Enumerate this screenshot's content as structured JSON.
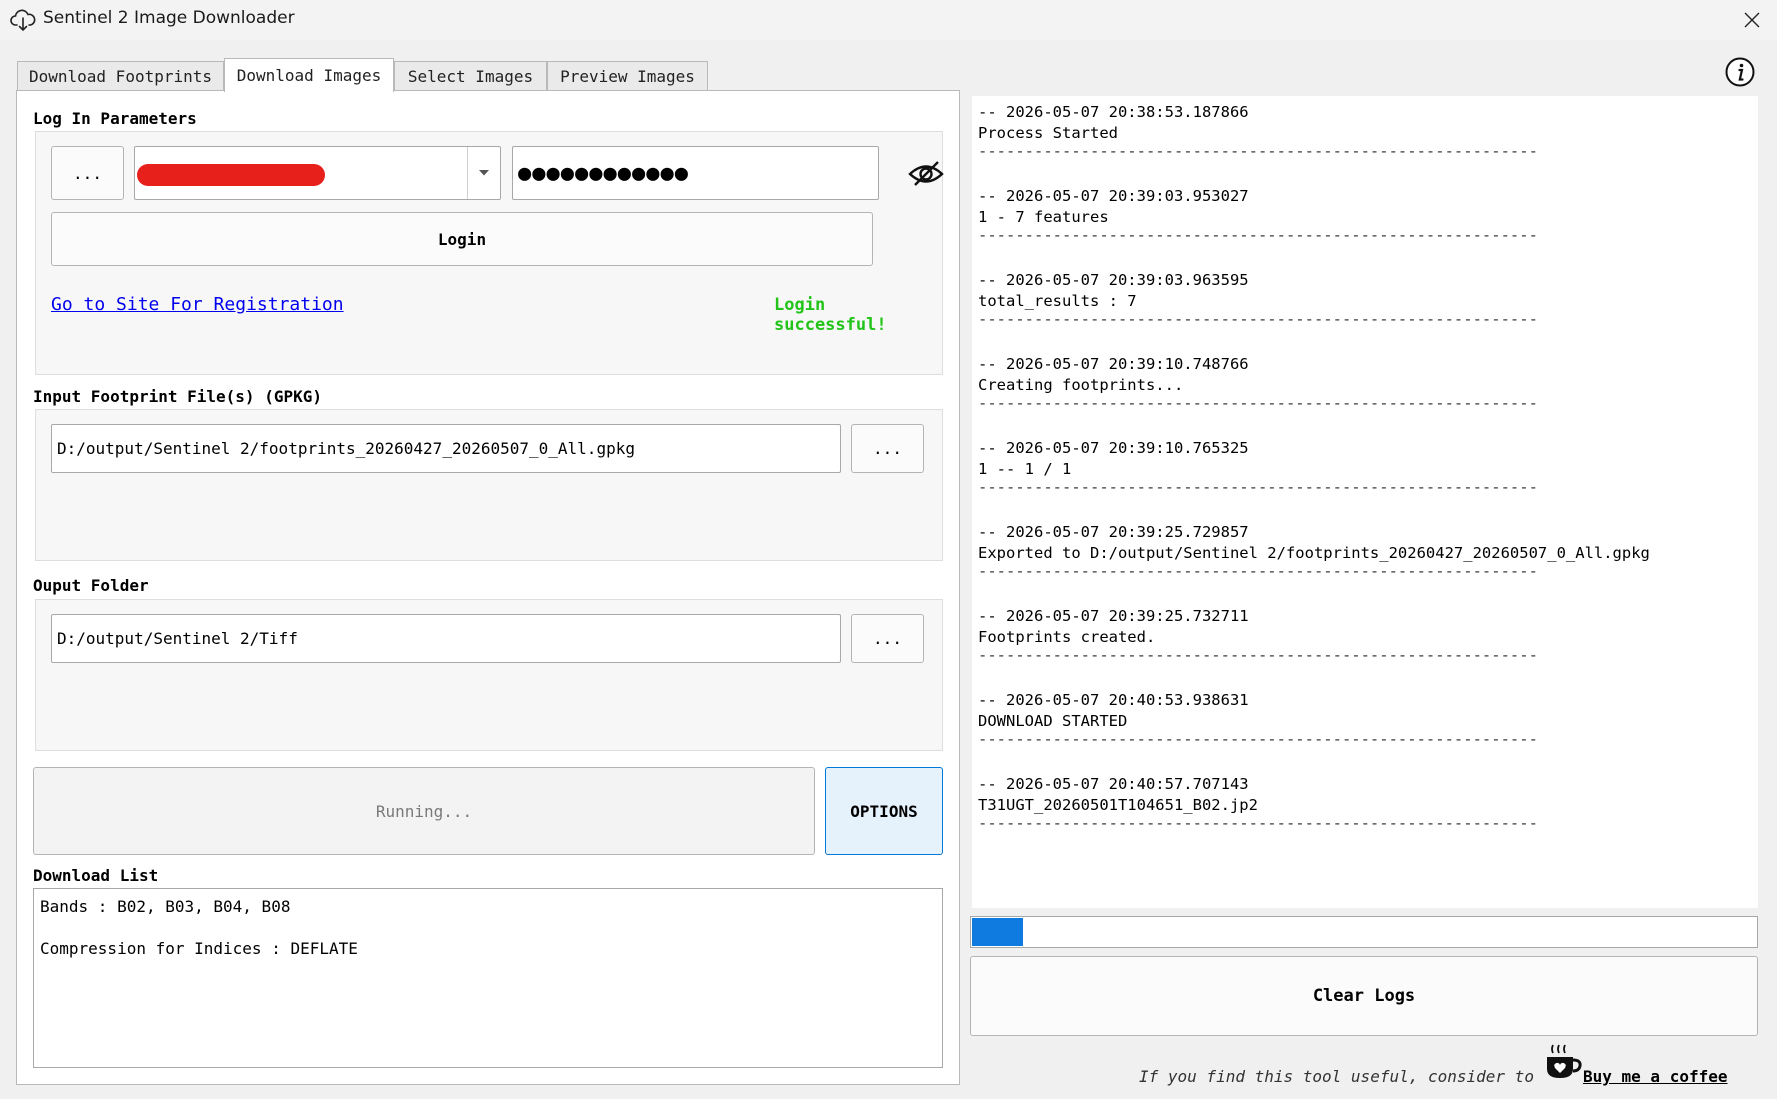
{
  "window": {
    "title": "Sentinel 2 Image Downloader"
  },
  "tabs": [
    {
      "label": "Download Footprints"
    },
    {
      "label": "Download Images"
    },
    {
      "label": "Select Images"
    },
    {
      "label": "Preview Images"
    }
  ],
  "login": {
    "group_label": "Log In Parameters",
    "browse_label": "...",
    "password_mask": "●●●●●●●●●●●●",
    "login_button": "Login",
    "register_link": "Go to Site For Registration",
    "status": "Login successful!"
  },
  "footprint": {
    "group_label": "Input Footprint File(s) (GPKG)",
    "path": "D:/output/Sentinel 2/footprints_20260427_20260507_0_All.gpkg",
    "browse_label": "..."
  },
  "output": {
    "group_label": "Ouput Folder",
    "path": "D:/output/Sentinel 2/Tiff",
    "browse_label": "..."
  },
  "run": {
    "running_label": "Running...",
    "options_label": "OPTIONS"
  },
  "download_list": {
    "label": "Download List",
    "line1": "Bands : B02, B03, B04, B08",
    "line2": "Compression for Indices : DEFLATE"
  },
  "logs": [
    {
      "time": "-- 2026-05-07 20:38:53.187866",
      "msg": "Process Started"
    },
    {
      "time": "-- 2026-05-07 20:39:03.953027",
      "msg": "1 - 7 features"
    },
    {
      "time": "-- 2026-05-07 20:39:03.963595",
      "msg": "total_results : 7"
    },
    {
      "time": "-- 2026-05-07 20:39:10.748766",
      "msg": "Creating footprints..."
    },
    {
      "time": "-- 2026-05-07 20:39:10.765325",
      "msg": "1 -- 1 / 1"
    },
    {
      "time": "-- 2026-05-07 20:39:25.729857",
      "msg": "Exported to D:/output/Sentinel 2/footprints_20260427_20260507_0_All.gpkg"
    },
    {
      "time": "-- 2026-05-07 20:39:25.732711",
      "msg": "Footprints created."
    },
    {
      "time": "-- 2026-05-07 20:40:53.938631",
      "msg": "DOWNLOAD STARTED"
    },
    {
      "time": "-- 2026-05-07 20:40:57.707143",
      "msg": "T31UGT_20260501T104651_B02.jp2"
    }
  ],
  "log_separator": "------------------------------------------------------------",
  "progress": {
    "value": 0.065,
    "color": "#0f7be0"
  },
  "clear_logs_label": "Clear Logs",
  "footer": {
    "text": "If you find this tool useful, consider to",
    "coffee_link": "Buy me a coffee"
  },
  "colors": {
    "status_green": "#22c41a",
    "link_blue": "#0000ee",
    "redaction": "#e8201c"
  }
}
